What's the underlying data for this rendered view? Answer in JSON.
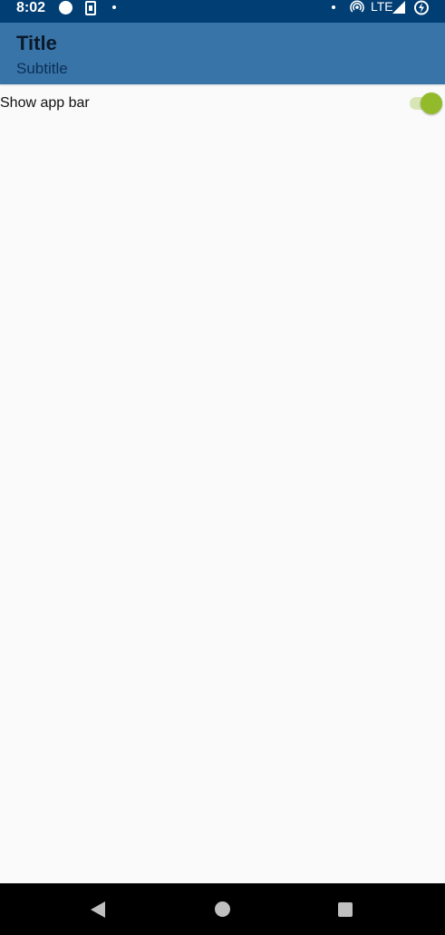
{
  "status_bar": {
    "time": "8:02",
    "network": "LTE",
    "background_color": "#003e74",
    "icons": [
      "notification-circle-icon",
      "sim-card-icon",
      "dot-icon",
      "dot-icon",
      "hotspot-icon",
      "signal-icon",
      "battery-charging-icon"
    ]
  },
  "app_bar": {
    "title": "Title",
    "subtitle": "Subtitle",
    "background_color": "#3874a8"
  },
  "settings": {
    "show_app_bar": {
      "label": "Show app bar",
      "checked": true,
      "accent_color": "#93ba2a"
    }
  },
  "navigation_bar": {
    "icons": [
      "back-icon",
      "home-icon",
      "recents-icon"
    ]
  }
}
